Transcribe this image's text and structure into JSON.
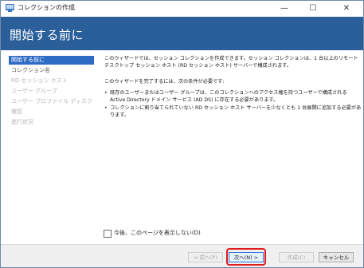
{
  "window": {
    "title": "コレクションの作成",
    "minimize_glyph": "—",
    "maximize_glyph": "☐",
    "close_glyph": "✕",
    "icon": "server-manager-icon"
  },
  "header": {
    "title": "開始する前に"
  },
  "nav": {
    "items": [
      {
        "label": "開始する前に",
        "state": "active"
      },
      {
        "label": "コレクション名",
        "state": "enabled"
      },
      {
        "label": "RD セッション ホスト",
        "state": "disabled"
      },
      {
        "label": "ユーザー グループ",
        "state": "disabled"
      },
      {
        "label": "ユーザー プロファイル ディスク",
        "state": "disabled"
      },
      {
        "label": "確認",
        "state": "disabled"
      },
      {
        "label": "進行状況",
        "state": "disabled"
      }
    ]
  },
  "main": {
    "intro": "このウィザードでは、セッション コレクションを作成できます。セッション コレクションは、1 台以上のリモート デスクトップ セッション ホスト (RD セッション ホスト) サーバーで構成されます。",
    "conditions_heading": "このウィザードを完了するには、次の条件が必要です:",
    "bullets": [
      "既存のユーザーまたはユーザー グループは、このコレクションへのアクセス権を持つユーザーで構成される Active Directory ドメイン サービス (AD DS) に存在する必要があります。",
      "コレクションに割り当てられていない RD セッション ホスト サーバーを少なくとも 1 台展開に追加する必要があります。"
    ],
    "bullet_glyph": "•",
    "skip_checkbox_label": "今後、このページを表示しない(D)",
    "skip_checkbox_checked": false
  },
  "footer": {
    "back_label": "< 前へ(P)",
    "next_label": "次へ(N) >",
    "create_label": "作成(C)",
    "cancel_label": "キャンセル"
  },
  "colors": {
    "header_bg": "#2b5f9a",
    "nav_active_bg": "#2e6bc4",
    "highlight_border": "#e01a1a"
  }
}
